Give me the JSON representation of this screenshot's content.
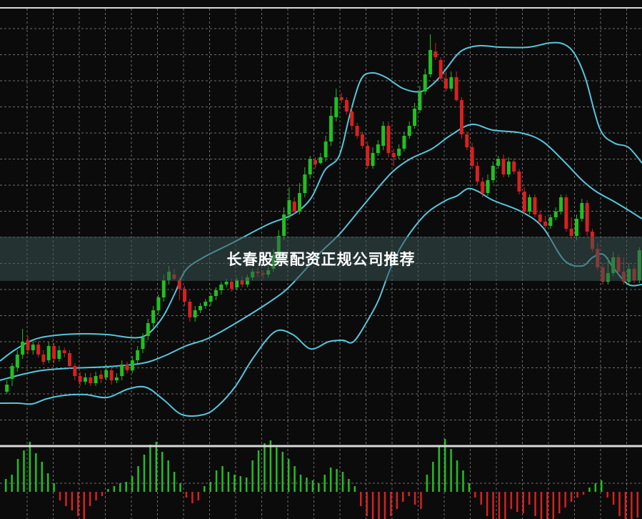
{
  "banner": {
    "title": "长春股票配资正规公司推荐"
  },
  "colors": {
    "background": "#0b0b0b",
    "grid": "#6e6e6e",
    "separator": "#d8d8d8",
    "up": "#20c020",
    "down": "#d82020",
    "band": "#55c6dc"
  },
  "chart_data": {
    "type": "candlestick",
    "grid": true,
    "panels": [
      "price",
      "histogram"
    ],
    "y_scale": "price",
    "candles": [
      [
        548,
        538,
        551,
        532
      ],
      [
        530,
        512,
        540,
        508
      ],
      [
        514,
        496,
        520,
        490
      ],
      [
        496,
        478,
        502,
        460
      ],
      [
        476,
        490,
        496,
        470
      ],
      [
        490,
        482,
        496,
        476
      ],
      [
        482,
        496,
        500,
        478
      ],
      [
        496,
        506,
        510,
        490
      ],
      [
        504,
        484,
        508,
        478
      ],
      [
        484,
        502,
        508,
        480
      ],
      [
        502,
        490,
        506,
        484
      ],
      [
        490,
        494,
        500,
        486
      ],
      [
        494,
        512,
        516,
        490
      ],
      [
        512,
        526,
        532,
        508
      ],
      [
        526,
        534,
        540,
        520
      ],
      [
        534,
        528,
        538,
        522
      ],
      [
        528,
        536,
        540,
        522
      ],
      [
        536,
        526,
        540,
        520
      ],
      [
        524,
        530,
        536,
        518
      ],
      [
        528,
        518,
        532,
        510
      ],
      [
        518,
        532,
        538,
        514
      ],
      [
        532,
        528,
        536,
        522
      ],
      [
        526,
        510,
        532,
        504
      ],
      [
        510,
        518,
        522,
        506
      ],
      [
        518,
        504,
        522,
        498
      ],
      [
        504,
        490,
        508,
        484
      ],
      [
        488,
        472,
        494,
        466
      ],
      [
        470,
        452,
        476,
        446
      ],
      [
        452,
        434,
        458,
        428
      ],
      [
        434,
        416,
        440,
        412
      ],
      [
        416,
        392,
        422,
        384
      ],
      [
        392,
        380,
        398,
        372
      ],
      [
        384,
        390,
        392,
        376
      ],
      [
        392,
        404,
        420,
        388
      ],
      [
        404,
        422,
        428,
        400
      ],
      [
        422,
        444,
        450,
        418
      ],
      [
        444,
        434,
        450,
        428
      ],
      [
        434,
        428,
        438,
        424
      ],
      [
        428,
        422,
        432,
        418
      ],
      [
        422,
        414,
        428,
        410
      ],
      [
        414,
        406,
        420,
        402
      ],
      [
        406,
        398,
        412,
        394
      ],
      [
        398,
        394,
        402,
        390
      ],
      [
        394,
        404,
        408,
        390
      ],
      [
        402,
        392,
        406,
        388
      ],
      [
        392,
        398,
        402,
        386
      ],
      [
        398,
        388,
        402,
        384
      ],
      [
        388,
        380,
        392,
        376
      ],
      [
        380,
        382,
        388,
        374
      ],
      [
        382,
        384,
        390,
        378
      ],
      [
        384,
        378,
        388,
        372
      ],
      [
        376,
        356,
        380,
        348
      ],
      [
        356,
        330,
        362,
        322
      ],
      [
        330,
        300,
        336,
        290
      ],
      [
        300,
        280,
        306,
        262
      ],
      [
        282,
        296,
        300,
        276
      ],
      [
        296,
        270,
        300,
        256
      ],
      [
        270,
        244,
        276,
        234
      ],
      [
        244,
        222,
        250,
        218
      ],
      [
        224,
        230,
        236,
        220
      ],
      [
        228,
        220,
        230,
        214
      ],
      [
        220,
        198,
        226,
        190
      ],
      [
        198,
        162,
        204,
        150
      ],
      [
        164,
        136,
        170,
        124
      ],
      [
        136,
        140,
        144,
        130
      ],
      [
        140,
        156,
        160,
        136
      ],
      [
        156,
        176,
        182,
        150
      ],
      [
        176,
        190,
        194,
        172
      ],
      [
        188,
        204,
        208,
        184
      ],
      [
        204,
        232,
        236,
        198
      ],
      [
        232,
        214,
        236,
        206
      ],
      [
        214,
        202,
        218,
        196
      ],
      [
        204,
        176,
        210,
        170
      ],
      [
        176,
        214,
        220,
        170
      ],
      [
        214,
        220,
        232,
        208
      ],
      [
        218,
        208,
        222,
        202
      ],
      [
        208,
        190,
        212,
        184
      ],
      [
        190,
        176,
        194,
        170
      ],
      [
        176,
        152,
        180,
        144
      ],
      [
        154,
        128,
        158,
        120
      ],
      [
        128,
        104,
        132,
        96
      ],
      [
        104,
        70,
        108,
        48
      ],
      [
        72,
        80,
        84,
        60
      ],
      [
        84,
        110,
        112,
        80
      ],
      [
        110,
        124,
        128,
        100
      ],
      [
        124,
        108,
        128,
        100
      ],
      [
        108,
        140,
        142,
        100
      ],
      [
        140,
        188,
        194,
        136
      ],
      [
        188,
        206,
        210,
        184
      ],
      [
        206,
        232,
        236,
        200
      ],
      [
        232,
        254,
        258,
        226
      ],
      [
        254,
        270,
        276,
        248
      ],
      [
        270,
        252,
        274,
        244
      ],
      [
        252,
        232,
        256,
        226
      ],
      [
        232,
        222,
        236,
        218
      ],
      [
        222,
        244,
        248,
        216
      ],
      [
        244,
        226,
        248,
        220
      ],
      [
        226,
        240,
        244,
        222
      ],
      [
        240,
        268,
        272,
        236
      ],
      [
        268,
        296,
        300,
        262
      ],
      [
        296,
        276,
        300,
        272
      ],
      [
        276,
        300,
        304,
        272
      ],
      [
        300,
        310,
        314,
        294
      ],
      [
        310,
        316,
        320,
        302
      ],
      [
        316,
        304,
        320,
        300
      ],
      [
        304,
        296,
        308,
        290
      ],
      [
        296,
        276,
        300,
        272
      ],
      [
        276,
        320,
        324,
        272
      ],
      [
        320,
        330,
        334,
        304
      ],
      [
        330,
        306,
        336,
        300
      ],
      [
        306,
        284,
        310,
        278
      ],
      [
        284,
        324,
        330,
        280
      ],
      [
        324,
        348,
        352,
        320
      ],
      [
        348,
        374,
        378,
        340
      ],
      [
        374,
        394,
        398,
        368
      ],
      [
        394,
        382,
        398,
        360
      ],
      [
        382,
        360,
        386,
        352
      ],
      [
        360,
        380,
        384,
        356
      ],
      [
        380,
        394,
        398,
        360
      ],
      [
        394,
        376,
        398,
        368
      ],
      [
        376,
        392,
        396,
        370
      ],
      [
        392,
        350,
        396,
        346
      ]
    ],
    "bands": {
      "upper": [
        [
          0,
          505
        ],
        [
          20,
          490
        ],
        [
          45,
          476
        ],
        [
          70,
          470
        ],
        [
          110,
          467
        ],
        [
          150,
          468
        ],
        [
          180,
          472
        ],
        [
          200,
          471
        ],
        [
          215,
          460
        ],
        [
          230,
          440
        ],
        [
          245,
          410
        ],
        [
          260,
          378
        ],
        [
          285,
          360
        ],
        [
          325,
          340
        ],
        [
          375,
          314
        ],
        [
          410,
          300
        ],
        [
          435,
          278
        ],
        [
          455,
          238
        ],
        [
          475,
          218
        ],
        [
          490,
          160
        ],
        [
          505,
          112
        ],
        [
          520,
          102
        ],
        [
          540,
          108
        ],
        [
          565,
          124
        ],
        [
          590,
          128
        ],
        [
          610,
          114
        ],
        [
          625,
          96
        ],
        [
          645,
          72
        ],
        [
          670,
          64
        ],
        [
          700,
          66
        ],
        [
          740,
          66
        ],
        [
          770,
          60
        ],
        [
          790,
          62
        ],
        [
          805,
          76
        ],
        [
          820,
          110
        ],
        [
          840,
          180
        ],
        [
          860,
          200
        ],
        [
          880,
          206
        ],
        [
          899,
          228
        ]
      ],
      "middle": [
        [
          0,
          532
        ],
        [
          30,
          524
        ],
        [
          60,
          518
        ],
        [
          100,
          515
        ],
        [
          150,
          513
        ],
        [
          200,
          508
        ],
        [
          230,
          498
        ],
        [
          260,
          484
        ],
        [
          290,
          474
        ],
        [
          320,
          458
        ],
        [
          350,
          440
        ],
        [
          375,
          424
        ],
        [
          400,
          406
        ],
        [
          425,
          380
        ],
        [
          450,
          352
        ],
        [
          475,
          328
        ],
        [
          500,
          298
        ],
        [
          525,
          268
        ],
        [
          550,
          240
        ],
        [
          575,
          222
        ],
        [
          605,
          208
        ],
        [
          630,
          190
        ],
        [
          660,
          174
        ],
        [
          690,
          182
        ],
        [
          730,
          186
        ],
        [
          760,
          198
        ],
        [
          790,
          226
        ],
        [
          815,
          252
        ],
        [
          835,
          268
        ],
        [
          860,
          282
        ],
        [
          880,
          294
        ],
        [
          899,
          306
        ]
      ],
      "lower": [
        [
          0,
          564
        ],
        [
          25,
          564
        ],
        [
          45,
          565
        ],
        [
          65,
          558
        ],
        [
          90,
          553
        ],
        [
          120,
          552
        ],
        [
          150,
          556
        ],
        [
          180,
          544
        ],
        [
          205,
          542
        ],
        [
          230,
          560
        ],
        [
          255,
          580
        ],
        [
          285,
          580
        ],
        [
          305,
          568
        ],
        [
          330,
          540
        ],
        [
          355,
          500
        ],
        [
          385,
          464
        ],
        [
          410,
          468
        ],
        [
          435,
          488
        ],
        [
          460,
          478
        ],
        [
          480,
          476
        ],
        [
          495,
          478
        ],
        [
          515,
          448
        ],
        [
          530,
          420
        ],
        [
          545,
          380
        ],
        [
          560,
          348
        ],
        [
          580,
          318
        ],
        [
          600,
          296
        ],
        [
          625,
          280
        ],
        [
          640,
          274
        ],
        [
          655,
          264
        ],
        [
          670,
          268
        ],
        [
          690,
          280
        ],
        [
          730,
          296
        ],
        [
          760,
          318
        ],
        [
          790,
          364
        ],
        [
          815,
          372
        ],
        [
          830,
          360
        ],
        [
          845,
          356
        ],
        [
          860,
          376
        ],
        [
          880,
          398
        ],
        [
          899,
          398
        ]
      ]
    },
    "histogram": [
      18,
      24,
      46,
      58,
      70,
      54,
      42,
      26,
      12,
      -12,
      -20,
      -26,
      -34,
      -38,
      -20,
      -12,
      -6,
      4,
      8,
      12,
      14,
      22,
      36,
      52,
      66,
      70,
      56,
      44,
      28,
      12,
      -8,
      -16,
      -12,
      8,
      14,
      30,
      36,
      28,
      24,
      22,
      20,
      44,
      58,
      68,
      72,
      62,
      56,
      46,
      36,
      24,
      20,
      16,
      12,
      24,
      34,
      32,
      28,
      18,
      8,
      -20,
      -34,
      -40,
      -46,
      -42,
      -34,
      -24,
      -14,
      -6,
      -18,
      -24,
      24,
      42,
      64,
      74,
      60,
      44,
      30,
      12,
      -8,
      -18,
      -34,
      -42,
      -42,
      -38,
      -24,
      -28,
      -30,
      -18,
      -34,
      -44,
      -40,
      -38,
      -30,
      -22,
      -14,
      -8,
      -4,
      6,
      12,
      16,
      -8,
      -18,
      -34,
      -40,
      -40,
      -36
    ]
  }
}
